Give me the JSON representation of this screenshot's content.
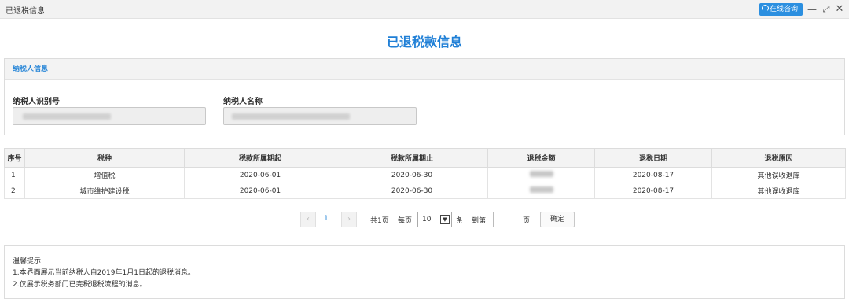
{
  "window": {
    "title": "已退税信息",
    "online_consult": "在线咨询",
    "minimize": "—",
    "maximize": "⤢",
    "close": "✕"
  },
  "page": {
    "title": "已退税款信息"
  },
  "taxpayer": {
    "section_title": "纳税人信息",
    "id_label": "纳税人识别号",
    "name_label": "纳税人名称"
  },
  "table": {
    "columns": [
      "序号",
      "税种",
      "税款所属期起",
      "税款所属期止",
      "退税金额",
      "退税日期",
      "退税原因"
    ],
    "rows": [
      {
        "seq": "1",
        "tax_type": "增值税",
        "period_start": "2020-06-01",
        "period_end": "2020-06-30",
        "refund_date": "2020-08-17",
        "reason": "其他误收退库"
      },
      {
        "seq": "2",
        "tax_type": "城市维护建设税",
        "period_start": "2020-06-01",
        "period_end": "2020-06-30",
        "refund_date": "2020-08-17",
        "reason": "其他误收退库"
      }
    ]
  },
  "pager": {
    "prev": "‹",
    "next": "›",
    "current_page": "1",
    "total": "共1页",
    "per_page_label": "每页",
    "per_page_value": "10",
    "per_page_unit": "条",
    "goto_label": "到第",
    "goto_unit": "页",
    "confirm": "确定"
  },
  "tips": {
    "title": "温馨提示:",
    "lines": [
      "1.本界面展示当前纳税人自2019年1月1日起的退税消息。",
      "2.仅展示税务部门已完税退税流程的消息。"
    ]
  },
  "colors": {
    "accent": "#1f7fd6",
    "button": "#2b8fe0"
  }
}
